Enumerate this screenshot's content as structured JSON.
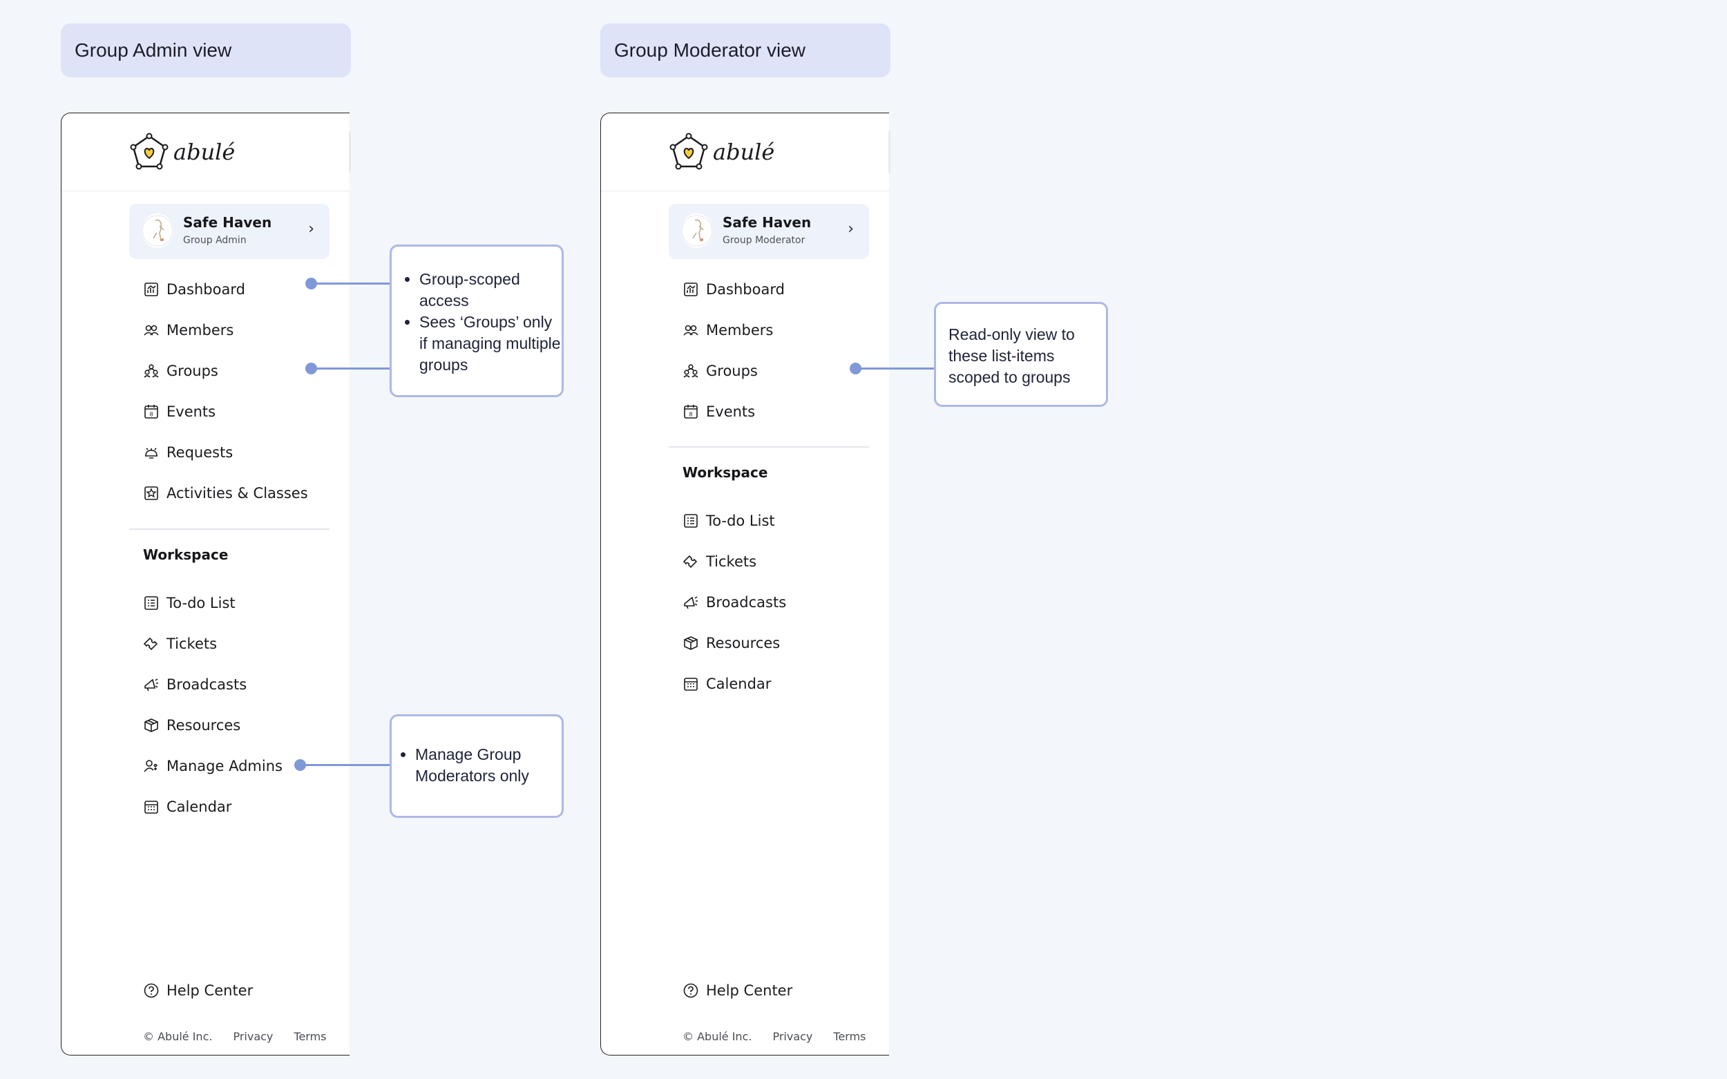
{
  "views": [
    {
      "label": "Group Admin view",
      "logo_text": "abulé",
      "org": {
        "name": "Safe Haven",
        "role": "Group Admin"
      },
      "nav": [
        {
          "label": "Dashboard",
          "icon": "dashboard-icon"
        },
        {
          "label": "Members",
          "icon": "members-icon"
        },
        {
          "label": "Groups",
          "icon": "groups-icon"
        },
        {
          "label": "Events",
          "icon": "events-icon"
        },
        {
          "label": "Requests",
          "icon": "requests-icon"
        },
        {
          "label": "Activities & Classes",
          "icon": "activities-icon"
        }
      ],
      "workspace_title": "Workspace",
      "workspace": [
        {
          "label": "To-do List",
          "icon": "todo-icon"
        },
        {
          "label": "Tickets",
          "icon": "ticket-icon"
        },
        {
          "label": "Broadcasts",
          "icon": "megaphone-icon"
        },
        {
          "label": "Resources",
          "icon": "box-icon"
        },
        {
          "label": "Manage Admins",
          "icon": "manage-admins-icon"
        },
        {
          "label": "Calendar",
          "icon": "calendar-icon"
        }
      ],
      "help": "Help Center",
      "footer": {
        "copyright": "© Abulé Inc.",
        "privacy": "Privacy",
        "terms": "Terms"
      }
    },
    {
      "label": "Group Moderator view",
      "logo_text": "abulé",
      "org": {
        "name": "Safe Haven",
        "role": "Group Moderator"
      },
      "nav": [
        {
          "label": "Dashboard",
          "icon": "dashboard-icon"
        },
        {
          "label": "Members",
          "icon": "members-icon"
        },
        {
          "label": "Groups",
          "icon": "groups-icon"
        },
        {
          "label": "Events",
          "icon": "events-icon"
        }
      ],
      "workspace_title": "Workspace",
      "workspace": [
        {
          "label": "To-do List",
          "icon": "todo-icon"
        },
        {
          "label": "Tickets",
          "icon": "ticket-icon"
        },
        {
          "label": "Broadcasts",
          "icon": "megaphone-icon"
        },
        {
          "label": "Resources",
          "icon": "box-icon"
        },
        {
          "label": "Calendar",
          "icon": "calendar-icon"
        }
      ],
      "help": "Help Center",
      "footer": {
        "copyright": "© Abulé Inc.",
        "privacy": "Privacy",
        "terms": "Terms"
      }
    }
  ],
  "callouts": {
    "admin_access": [
      "Group-scoped access",
      "Sees ‘Groups’ only if managing multiple groups"
    ],
    "admin_manage": [
      "Manage Group Moderators only"
    ],
    "moderator_readonly": "Read-only view to these list-items scoped to groups"
  },
  "colors": {
    "background": "#f3f6fb",
    "label_bg": "#dfe3f7",
    "callout_border": "#aeb8e4",
    "connector": "#7f98d8",
    "card_bg": "#eef2fb"
  }
}
